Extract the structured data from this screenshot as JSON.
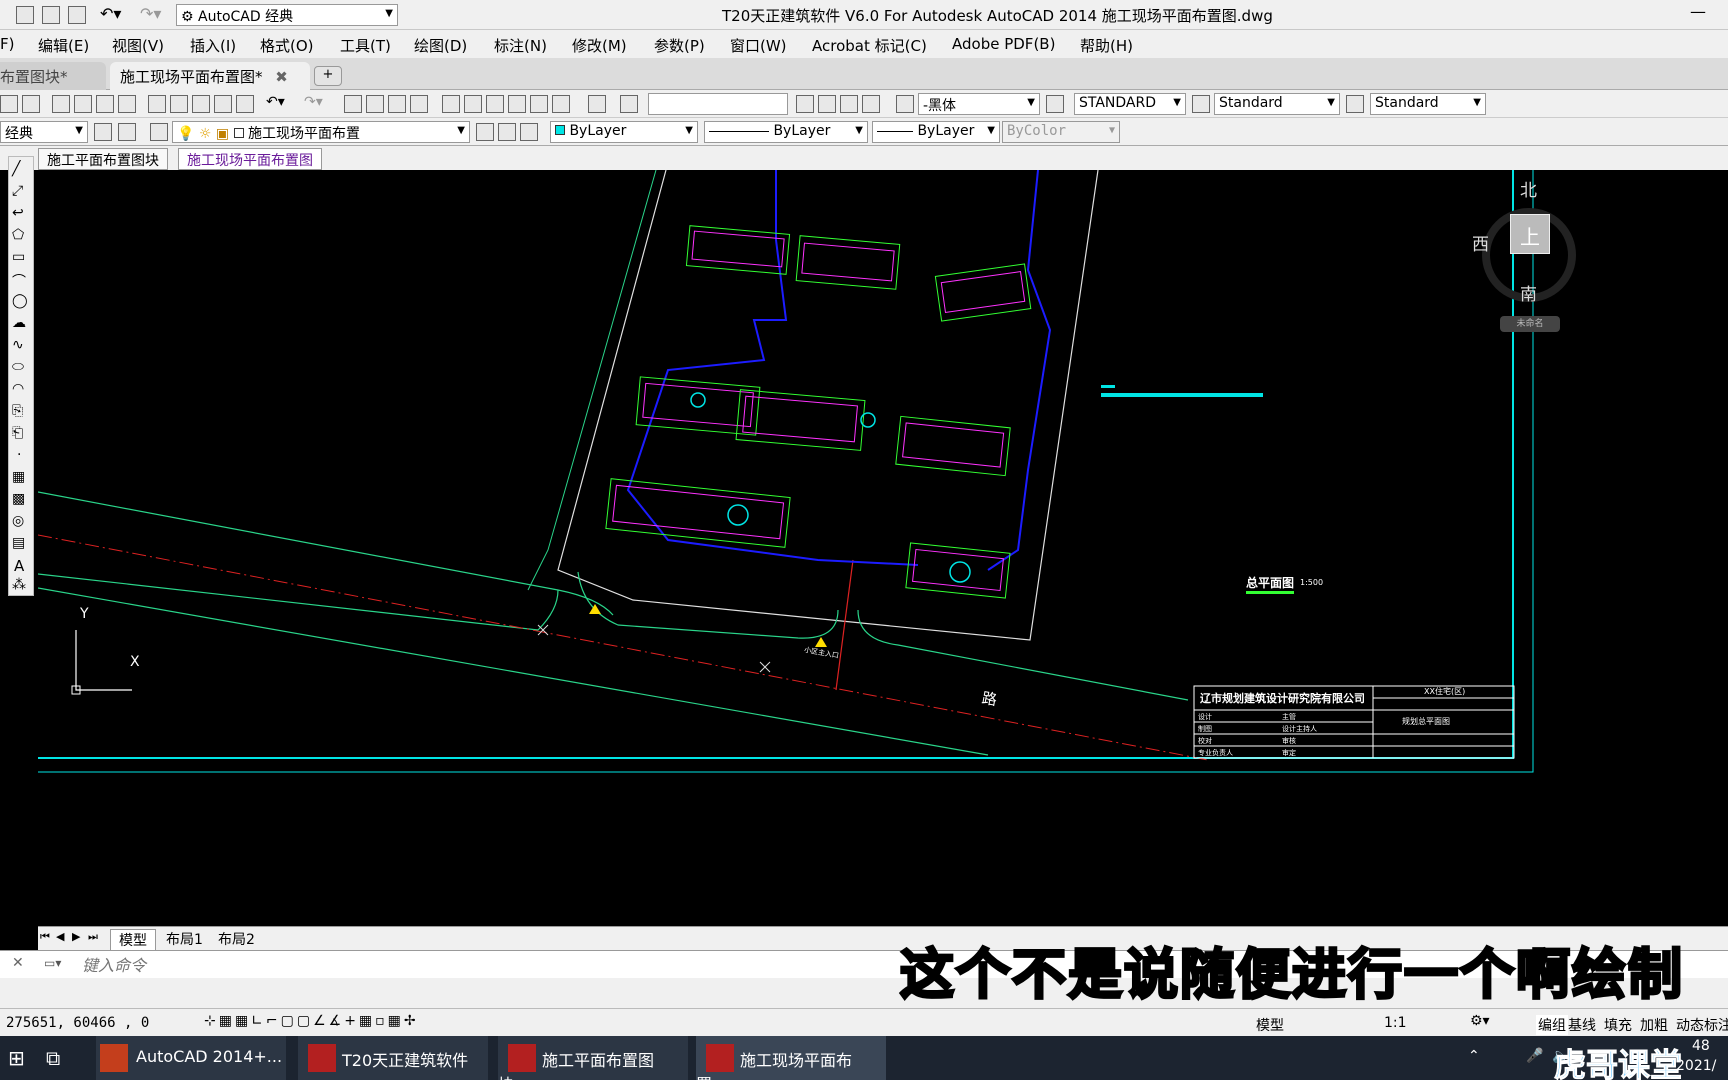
{
  "window": {
    "title": "T20天正建筑软件 V6.0 For Autodesk AutoCAD 2014    施工现场平面布置图.dwg",
    "workspace": "AutoCAD 经典"
  },
  "menu": [
    "F)",
    "编辑(E)",
    "视图(V)",
    "插入(I)",
    "格式(O)",
    "工具(T)",
    "绘图(D)",
    "标注(N)",
    "修改(M)",
    "参数(P)",
    "窗口(W)",
    "Acrobat 标记(C)",
    "Adobe PDF(B)",
    "帮助(H)"
  ],
  "file_tabs": [
    {
      "label": "布置图块*"
    },
    {
      "label": "施工现场平面布置图*"
    }
  ],
  "toolbar": {
    "font_combo": "-黑体",
    "textstyle_combo": "STANDARD",
    "dimstyle_combo": "Standard",
    "tablestyle_combo": "Standard"
  },
  "layer_bar": {
    "workspace_short": "经典",
    "layer_name": "施工现场平面布置",
    "color": "ByLayer",
    "linetype": "ByLayer",
    "lineweight": "ByLayer",
    "plotstyle": "ByColor"
  },
  "doc_tabs": [
    "施工平面布置图块",
    "施工现场平面布置图"
  ],
  "viewcube": {
    "north": "北",
    "south": "南",
    "west": "西",
    "top": "上",
    "wcs": "未命名"
  },
  "drawing": {
    "plan_title": "总平面图",
    "plan_scale": "1:500",
    "road_char": "路",
    "entrance_label": "小区主入口",
    "company": "辽市规划建筑设计研究院有限公司",
    "titleblock_project": "XX住宅(区)",
    "titleblock_drawing": "规划总平面图",
    "titleblock_rows": [
      "设计",
      "制图",
      "校对",
      "专业负责人"
    ],
    "titleblock_cells": [
      "主管",
      "设计主持人",
      "审核",
      "审定"
    ],
    "ucs_y": "Y",
    "ucs_x": "X"
  },
  "layout_tabs": [
    "模型",
    "布局1",
    "布局2"
  ],
  "command": {
    "placeholder": "键入命令"
  },
  "subtitle": "这个不是说随便进行一个啊绘制的",
  "status": {
    "coords": "275651, 60466 , 0",
    "model": "模型",
    "scale": "1:1",
    "right_items": [
      "编组",
      "基线",
      "填充",
      "加粗",
      "动态标注"
    ]
  },
  "taskbar": {
    "items": [
      "AutoCAD 2014+...",
      "T20天正建筑软件 ...",
      "施工平面布置图块....",
      "施工现场平面布置...."
    ],
    "clock_date": "2021/",
    "clock_time": "48",
    "watermark": "虎哥课堂"
  },
  "colors": {
    "accent_cyan": "#00e5e5",
    "cad_bg": "#000000",
    "green": "#33ff33",
    "blue": "#1c1cff",
    "magenta": "#ff33ff",
    "yellow": "#ffdd00",
    "red": "#dd2222"
  }
}
